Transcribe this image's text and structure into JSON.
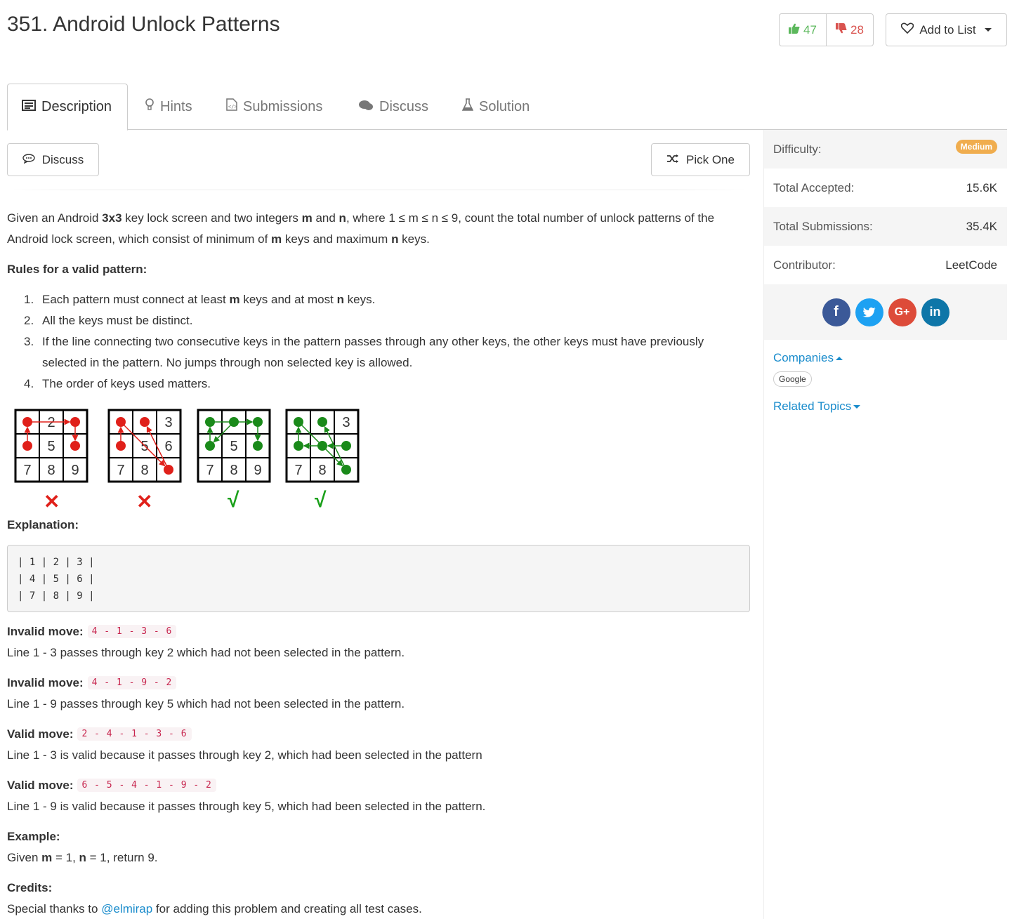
{
  "problem": {
    "title": "351. Android Unlock Patterns",
    "upvotes": "47",
    "downvotes": "28",
    "add_to_list": "Add to List"
  },
  "tabs": [
    {
      "label": "Description",
      "icon": "description-icon"
    },
    {
      "label": "Hints",
      "icon": "lightbulb-icon"
    },
    {
      "label": "Submissions",
      "icon": "code-file-icon"
    },
    {
      "label": "Discuss",
      "icon": "chat-bubbles-icon"
    },
    {
      "label": "Solution",
      "icon": "flask-icon"
    }
  ],
  "actions": {
    "discuss": "Discuss",
    "pick_one": "Pick One"
  },
  "description": {
    "intro_1": "Given an Android ",
    "intro_bold_1": "3x3",
    "intro_2": " key lock screen and two integers ",
    "intro_bold_m": "m",
    "intro_3": " and ",
    "intro_bold_n": "n",
    "intro_4": ", where 1 ≤ m ≤ n ≤ 9, count the total number of unlock patterns of the Android lock screen, which consist of minimum of ",
    "intro_bold_m2": "m",
    "intro_5": " keys and maximum ",
    "intro_bold_n2": "n",
    "intro_6": " keys.",
    "rules_title": "Rules for a valid pattern:",
    "rules": [
      {
        "num": "1.",
        "a": "Each pattern must connect at least ",
        "m": "m",
        "b": " keys and at most ",
        "n": "n",
        "c": " keys."
      },
      {
        "num": "2.",
        "text": "All the keys must be distinct."
      },
      {
        "num": "3.",
        "text": "If the line connecting two consecutive keys in the pattern passes through any other keys, the other keys must have previously selected in the pattern. No jumps through non selected key is allowed."
      },
      {
        "num": "4.",
        "text": "The order of keys used matters."
      }
    ],
    "explanation_title": "Explanation:",
    "grid_block": "| 1 | 2 | 3 |\n| 4 | 5 | 6 |\n| 7 | 8 | 9 |",
    "moves": [
      {
        "label": "Invalid move:",
        "seq": "4 - 1 - 3 - 6",
        "desc": "Line 1 - 3 passes through key 2 which had not been selected in the pattern."
      },
      {
        "label": "Invalid move:",
        "seq": "4 - 1 - 9 - 2",
        "desc": "Line 1 - 9 passes through key 5 which had not been selected in the pattern."
      },
      {
        "label": "Valid move:",
        "seq": "2 - 4 - 1 - 3 - 6",
        "desc": "Line 1 - 3 is valid because it passes through key 2, which had been selected in the pattern"
      },
      {
        "label": "Valid move:",
        "seq": "6 - 5 - 4 - 1 - 9 - 2",
        "desc": "Line 1 - 9 is valid because it passes through key 5, which had been selected in the pattern."
      }
    ],
    "example_title": "Example:",
    "example_1": "Given ",
    "example_m": "m",
    "example_2": " = 1, ",
    "example_n": "n",
    "example_3": " = 1, return 9.",
    "credits_title": "Credits:",
    "credits_1": "Special thanks to ",
    "credits_link": "@elmirap",
    "credits_2": " for adding this problem and creating all test cases."
  },
  "pattern_figures": [
    {
      "verdict": "✕",
      "keys": [
        "1",
        "2",
        "3",
        "4",
        "5",
        "6",
        "7",
        "8",
        "9"
      ]
    },
    {
      "verdict": "✕",
      "keys": [
        "1",
        "2",
        "3",
        "4",
        "5",
        "6",
        "7",
        "8",
        "9"
      ]
    },
    {
      "verdict": "√",
      "keys": [
        "1",
        "2",
        "3",
        "4",
        "5",
        "6",
        "7",
        "8",
        "9"
      ]
    },
    {
      "verdict": "√",
      "keys": [
        "1",
        "2",
        "3",
        "4",
        "5",
        "6",
        "7",
        "8",
        "9"
      ]
    }
  ],
  "sidebar": {
    "difficulty_label": "Difficulty:",
    "difficulty_value": "Medium",
    "accepted_label": "Total Accepted:",
    "accepted_value": "15.6K",
    "submissions_label": "Total Submissions:",
    "submissions_value": "35.4K",
    "contributor_label": "Contributor:",
    "contributor_value": "LeetCode",
    "social": [
      {
        "name": "facebook-icon",
        "glyph": "f",
        "color": "#3b5998"
      },
      {
        "name": "twitter-icon",
        "glyph": "t",
        "color": "#1da1f2"
      },
      {
        "name": "google-plus-icon",
        "glyph": "G+",
        "color": "#dd4b39"
      },
      {
        "name": "linkedin-icon",
        "glyph": "in",
        "color": "#0e76a8"
      }
    ],
    "companies_label": "Companies",
    "company_tag": "Google",
    "related_topics_label": "Related Topics"
  },
  "colors": {
    "link": "#1a8ccc",
    "difficulty_medium": "#f0ad4e",
    "upvote": "#5cb85c",
    "downvote": "#d9534f",
    "invalid_pattern": "#e0201a",
    "valid_pattern": "#1a8a1a"
  }
}
